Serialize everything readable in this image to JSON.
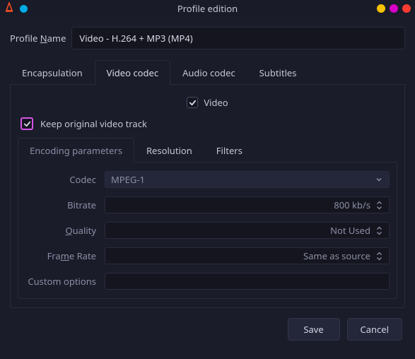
{
  "window": {
    "title": "Profile edition"
  },
  "profile": {
    "name_label_pre": "Profile ",
    "name_label_u": "N",
    "name_label_post": "ame",
    "name_value": "Video - H.264 + MP3 (MP4)"
  },
  "tabs": {
    "encapsulation": "Encapsulation",
    "video_codec": "Video codec",
    "audio_codec": "Audio codec",
    "subtitles": "Subtitles"
  },
  "video_section": {
    "video_label": "Video",
    "keep_label": "Keep original video track"
  },
  "subtabs": {
    "encoding": "Encoding parameters",
    "resolution": "Resolution",
    "filters": "Filters"
  },
  "form": {
    "codec_label": "Codec",
    "codec_value": "MPEG-1",
    "bitrate_label": "Bitrate",
    "bitrate_value": "800 kb/s",
    "quality_label_u": "Q",
    "quality_label_post": "uality",
    "quality_value": "Not Used",
    "framerate_pre": "Fra",
    "framerate_u": "m",
    "framerate_post": "e Rate",
    "framerate_value": "Same as source",
    "custom_label": "Custom options",
    "custom_value": ""
  },
  "buttons": {
    "save": "Save",
    "cancel": "Cancel"
  }
}
